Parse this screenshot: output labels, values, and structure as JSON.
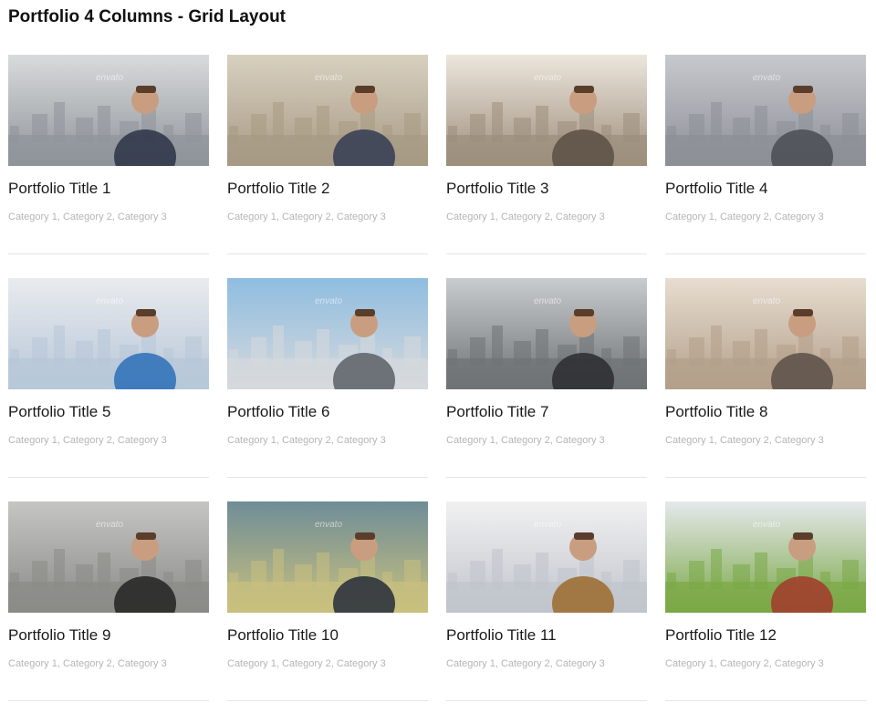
{
  "page": {
    "title": "Portfolio 4 Columns - Grid Layout"
  },
  "watermark": "envato",
  "items": [
    {
      "title": "Portfolio Title 1",
      "categories": [
        "Category 1",
        "Category 2",
        "Category 3"
      ],
      "image": "businessman-superhero-city-photo",
      "palette": [
        "#d9dbdc",
        "#8f949a",
        "#2b3346"
      ]
    },
    {
      "title": "Portfolio Title 2",
      "categories": [
        "Category 1",
        "Category 2",
        "Category 3"
      ],
      "image": "man-with-pipe-typewriter-photo",
      "palette": [
        "#d8d0c0",
        "#a79a84",
        "#333c52"
      ]
    },
    {
      "title": "Portfolio Title 3",
      "categories": [
        "Category 1",
        "Category 2",
        "Category 3"
      ],
      "image": "cyclist-on-rock-photo",
      "palette": [
        "#ece6dc",
        "#9d8e7c",
        "#5b4f44"
      ]
    },
    {
      "title": "Portfolio Title 4",
      "categories": [
        "Category 1",
        "Category 2",
        "Category 3"
      ],
      "image": "hiker-over-city-photo",
      "palette": [
        "#c7c9ce",
        "#8c8f96",
        "#4a4c52"
      ]
    },
    {
      "title": "Portfolio Title 5",
      "categories": [
        "Category 1",
        "Category 2",
        "Category 3"
      ],
      "image": "tablet-chart-meeting-photo",
      "palette": [
        "#e9ebee",
        "#b7c7d8",
        "#2b6fb7"
      ]
    },
    {
      "title": "Portfolio Title 6",
      "categories": [
        "Category 1",
        "Category 2",
        "Category 3"
      ],
      "image": "relaxing-man-skyline-photo",
      "palette": [
        "#8fbde0",
        "#d6d9dc",
        "#5b6066"
      ]
    },
    {
      "title": "Portfolio Title 7",
      "categories": [
        "Category 1",
        "Category 2",
        "Category 3"
      ],
      "image": "man-tablet-screens-photo",
      "palette": [
        "#c9ccce",
        "#6e7275",
        "#2a2c2e"
      ]
    },
    {
      "title": "Portfolio Title 8",
      "categories": [
        "Category 1",
        "Category 2",
        "Category 3"
      ],
      "image": "laptop-hot-air-balloon-photo",
      "palette": [
        "#e7ddd0",
        "#b39f8a",
        "#5a5048"
      ]
    },
    {
      "title": "Portfolio Title 9",
      "categories": [
        "Category 1",
        "Category 2",
        "Category 3"
      ],
      "image": "man-umbrella-sketch-photo",
      "palette": [
        "#c5c5c3",
        "#8a8a87",
        "#222222"
      ]
    },
    {
      "title": "Portfolio Title 10",
      "categories": [
        "Category 1",
        "Category 2",
        "Category 3"
      ],
      "image": "growth-arrow-businessman-photo",
      "palette": [
        "#6f8d97",
        "#c9c07e",
        "#252b38"
      ]
    },
    {
      "title": "Portfolio Title 11",
      "categories": [
        "Category 1",
        "Category 2",
        "Category 3"
      ],
      "image": "magnifier-contract-signing-photo",
      "palette": [
        "#f1f1f1",
        "#c0c4cc",
        "#9b6a2c"
      ]
    },
    {
      "title": "Portfolio Title 12",
      "categories": [
        "Category 1",
        "Category 2",
        "Category 3"
      ],
      "image": "hiker-green-field-city-photo",
      "palette": [
        "#e5e8ec",
        "#7aa845",
        "#a23a2c"
      ]
    }
  ]
}
